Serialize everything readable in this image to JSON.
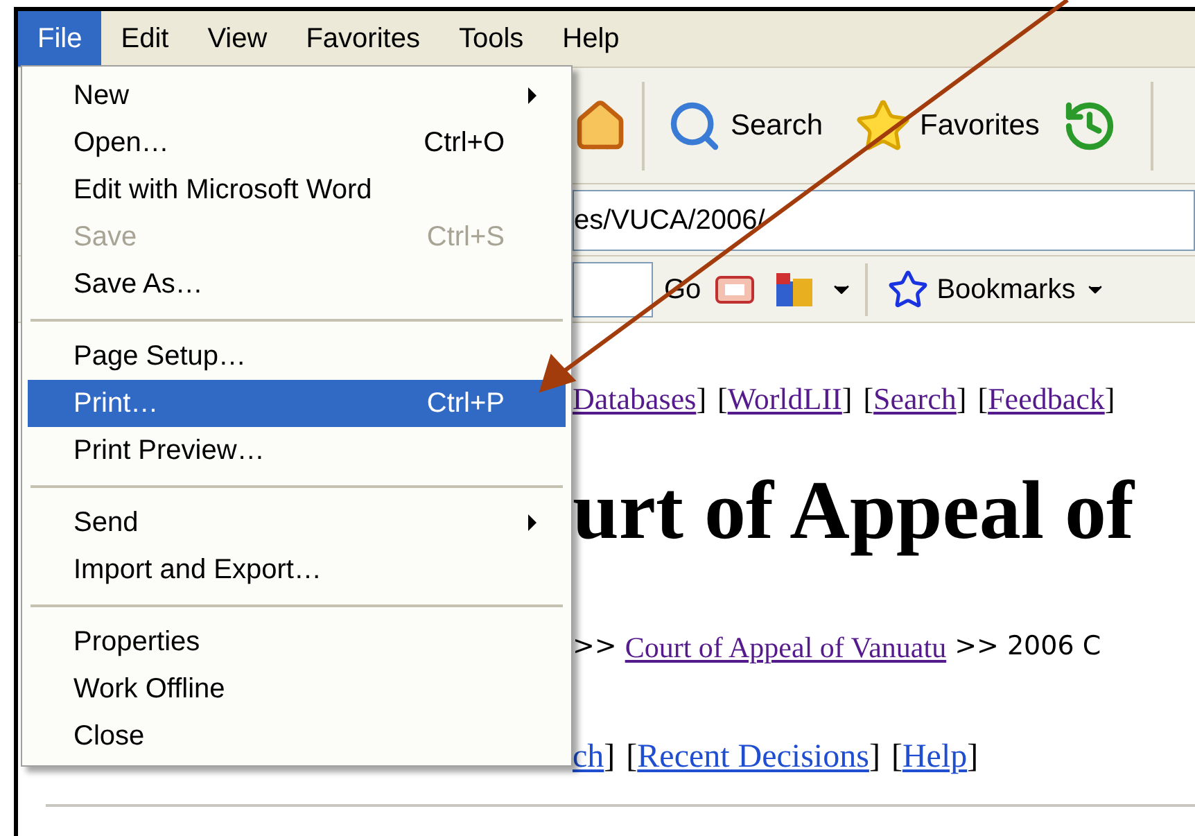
{
  "menu_bar": [
    {
      "label": "File",
      "selected": true
    },
    {
      "label": "Edit",
      "selected": false
    },
    {
      "label": "View",
      "selected": false
    },
    {
      "label": "Favorites",
      "selected": false
    },
    {
      "label": "Tools",
      "selected": false
    },
    {
      "label": "Help",
      "selected": false
    }
  ],
  "file_menu": {
    "groups": [
      [
        {
          "label": "New",
          "submenu": true,
          "disabled": false,
          "selected": false
        },
        {
          "label": "Open…",
          "shortcut": "Ctrl+O",
          "submenu": false,
          "disabled": false,
          "selected": false
        },
        {
          "label": "Edit with Microsoft Word",
          "submenu": false,
          "disabled": false,
          "selected": false
        },
        {
          "label": "Save",
          "shortcut": "Ctrl+S",
          "submenu": false,
          "disabled": true,
          "selected": false
        },
        {
          "label": "Save As…",
          "submenu": false,
          "disabled": false,
          "selected": false
        }
      ],
      [
        {
          "label": "Page Setup…",
          "submenu": false,
          "disabled": false,
          "selected": false
        },
        {
          "label": "Print…",
          "shortcut": "Ctrl+P",
          "submenu": false,
          "disabled": false,
          "selected": true
        },
        {
          "label": "Print Preview…",
          "submenu": false,
          "disabled": false,
          "selected": false
        }
      ],
      [
        {
          "label": "Send",
          "submenu": true,
          "disabled": false,
          "selected": false
        },
        {
          "label": "Import and Export…",
          "submenu": false,
          "disabled": false,
          "selected": false
        }
      ],
      [
        {
          "label": "Properties",
          "submenu": false,
          "disabled": false,
          "selected": false
        },
        {
          "label": "Work Offline",
          "submenu": false,
          "disabled": false,
          "selected": false
        },
        {
          "label": "Close",
          "submenu": false,
          "disabled": false,
          "selected": false
        }
      ]
    ]
  },
  "toolbar": {
    "buttons": [
      {
        "kind": "search",
        "label": "Search"
      },
      {
        "kind": "favorites",
        "label": "Favorites"
      }
    ]
  },
  "address_bar": {
    "value": "es/VUCA/2006/"
  },
  "links_bar": {
    "go": "Go",
    "bookmarks": "Bookmarks"
  },
  "page": {
    "nav_links": [
      {
        "kind": "link",
        "text": "Databases"
      },
      {
        "kind": "text",
        "text": "]"
      },
      {
        "kind": "text",
        "text": "["
      },
      {
        "kind": "link",
        "text": "WorldLII"
      },
      {
        "kind": "text",
        "text": "]"
      },
      {
        "kind": "text",
        "text": "["
      },
      {
        "kind": "link",
        "text": "Search"
      },
      {
        "kind": "text",
        "text": "]"
      },
      {
        "kind": "text",
        "text": "["
      },
      {
        "kind": "link",
        "text": "Feedback"
      },
      {
        "kind": "text",
        "text": "]"
      }
    ],
    "heading": "urt of Appeal of",
    "breadcrumb": {
      "prefix": ">>",
      "link": "Court of Appeal of Vanuatu",
      "suffix": ">> 2006 C"
    },
    "bottom_links": [
      {
        "kind": "link",
        "text": "ch"
      },
      {
        "kind": "text",
        "text": "]"
      },
      {
        "kind": "text",
        "text": "["
      },
      {
        "kind": "link",
        "text": "Recent Decisions"
      },
      {
        "kind": "text",
        "text": "]"
      },
      {
        "kind": "text",
        "text": "["
      },
      {
        "kind": "link",
        "text": "Help"
      },
      {
        "kind": "text",
        "text": "]"
      }
    ]
  }
}
